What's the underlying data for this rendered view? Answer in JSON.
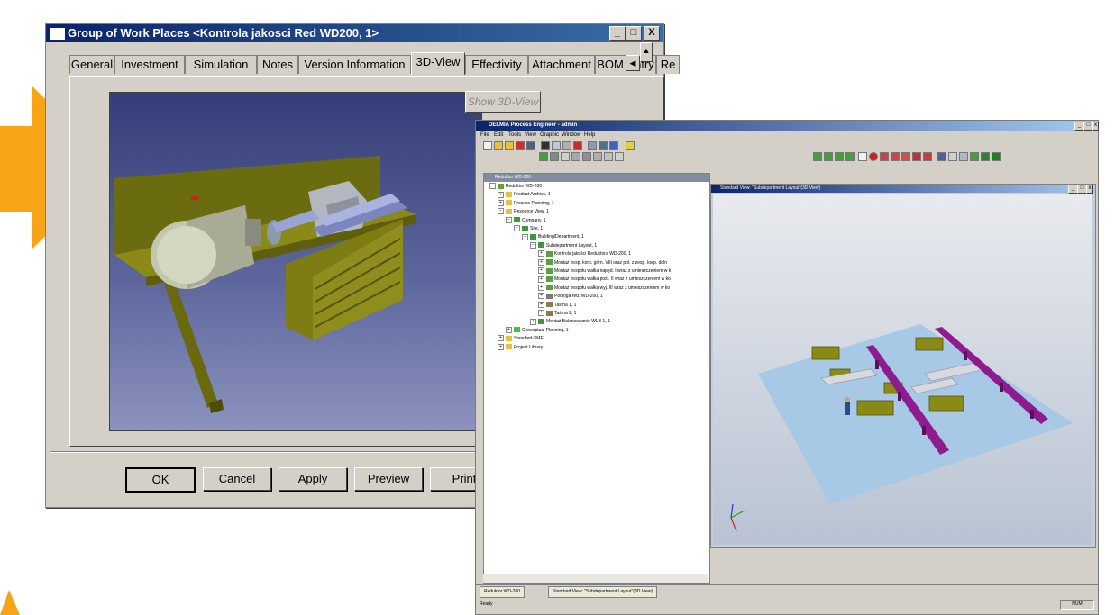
{
  "dialog": {
    "title": "Group of Work Places <Kontrola jakosci Red WD200, 1>",
    "controls": {
      "minimize": "_",
      "maximize": "□",
      "close": "X"
    },
    "tabs": [
      "General",
      "Investment",
      "Simulation",
      "Notes",
      "Version Information",
      "3D-View",
      "Effectivity",
      "Attachment",
      "BOM Entry",
      "Re"
    ],
    "active_tab": "3D-View",
    "show_3d_button": "Show 3D-View",
    "buttons": {
      "ok": "OK",
      "cancel": "Cancel",
      "apply": "Apply",
      "preview": "Preview",
      "print": "Print"
    }
  },
  "delmia": {
    "title": "DELMIA Process Engineer - admin",
    "menu": [
      "File",
      "Edit",
      "Tools",
      "View",
      "Graphic",
      "Window",
      "Help"
    ],
    "tree_title": "Reduktor WD-200",
    "tree": [
      {
        "label": "Reduktor WD-200",
        "depth": 0,
        "exp": "−",
        "icon": "#6ca030"
      },
      {
        "label": "Product Archive, 1",
        "depth": 1,
        "exp": "+",
        "icon": "#e8c040"
      },
      {
        "label": "Process Planning, 1",
        "depth": 1,
        "exp": "+",
        "icon": "#e8c040"
      },
      {
        "label": "Resource View, 1",
        "depth": 1,
        "exp": "−",
        "icon": "#e8c040"
      },
      {
        "label": "Company, 1",
        "depth": 2,
        "exp": "−",
        "icon": "#3a9a3a"
      },
      {
        "label": "Site, 1",
        "depth": 3,
        "exp": "−",
        "icon": "#3a9a3a"
      },
      {
        "label": "Building/Department, 1",
        "depth": 4,
        "exp": "−",
        "icon": "#3a9a3a"
      },
      {
        "label": "Subdepartment Layout, 1",
        "depth": 5,
        "exp": "−",
        "icon": "#3a9a3a"
      },
      {
        "label": "Kontrola jakości Reduktora WD-200, 1",
        "depth": 6,
        "exp": "+",
        "icon": "#5aa040"
      },
      {
        "label": "Montaż zesp. korp. górn. VIII oraz pol. z zesp. korp. doln",
        "depth": 6,
        "exp": "+",
        "icon": "#5aa040"
      },
      {
        "label": "Montaż zespołu wałka napęd. I wraz z umieszczeniem w k",
        "depth": 6,
        "exp": "+",
        "icon": "#5aa040"
      },
      {
        "label": "Montaż zespołu wałka pośr. II wraz z umieszczeniem w ko",
        "depth": 6,
        "exp": "+",
        "icon": "#5aa040"
      },
      {
        "label": "Montaż zespołu wałka wyj. III wraz z umieszczeniem w ko",
        "depth": 6,
        "exp": "+",
        "icon": "#5aa040"
      },
      {
        "label": "Podłoga red. WD-200, 1",
        "depth": 6,
        "exp": "+",
        "icon": "#7a7a7a"
      },
      {
        "label": "Taśma 1, 1",
        "depth": 6,
        "exp": "+",
        "icon": "#8a7a50"
      },
      {
        "label": "Taśma 2, 1",
        "depth": 6,
        "exp": "+",
        "icon": "#8a7a50"
      },
      {
        "label": "Montaż Balansowanie WLB 1, 1",
        "depth": 5,
        "exp": "+",
        "icon": "#3a9a3a"
      },
      {
        "label": "Conceptual Planning, 1",
        "depth": 2,
        "exp": "+",
        "icon": "#48c048"
      },
      {
        "label": "Standard-SME",
        "depth": 1,
        "exp": "+",
        "icon": "#e8c040"
      },
      {
        "label": "Project Library",
        "depth": 1,
        "exp": "+",
        "icon": "#e8c040"
      }
    ],
    "view_title": "Standard View: \"Subdepartment Layout\"(3D View)",
    "window_tabs": [
      "Reduktor WD-200",
      "Standard View: \"Subdepartment Layout\"(3D View)"
    ],
    "status": "Ready",
    "status_num": "NUM"
  },
  "colors": {
    "arrow": "#f7a416",
    "title_bar": "#0a246a",
    "machine": "#7a7a0c",
    "conveyor": "#8e1c8e",
    "floor": "#a8c9e6"
  }
}
